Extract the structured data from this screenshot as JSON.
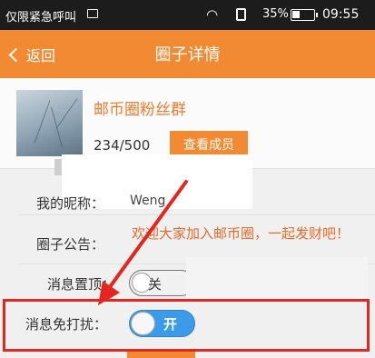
{
  "status_bar": {
    "carrier": "仅限紧急呼叫",
    "battery_pct": "35%",
    "time": "09:55"
  },
  "nav": {
    "back_label": "返回",
    "title": "圈子详情"
  },
  "group": {
    "name": "邮币圈粉丝群",
    "member_count": "234/500",
    "view_members_label": "查看成员"
  },
  "rows": {
    "nickname_label": "我的昵称：",
    "nickname_value": "Weng",
    "notice_label": "圈子公告：",
    "notice_text": "欢迎大家加入邮币圈，一起发财吧！",
    "pin_label": "消息置顶：",
    "pin_state": "关",
    "dnd_label": "消息免打扰：",
    "dnd_state": "开"
  },
  "colors": {
    "brand_orange": "#f28a33",
    "highlight_red": "#e3271f",
    "toggle_blue": "#3b9be8"
  }
}
